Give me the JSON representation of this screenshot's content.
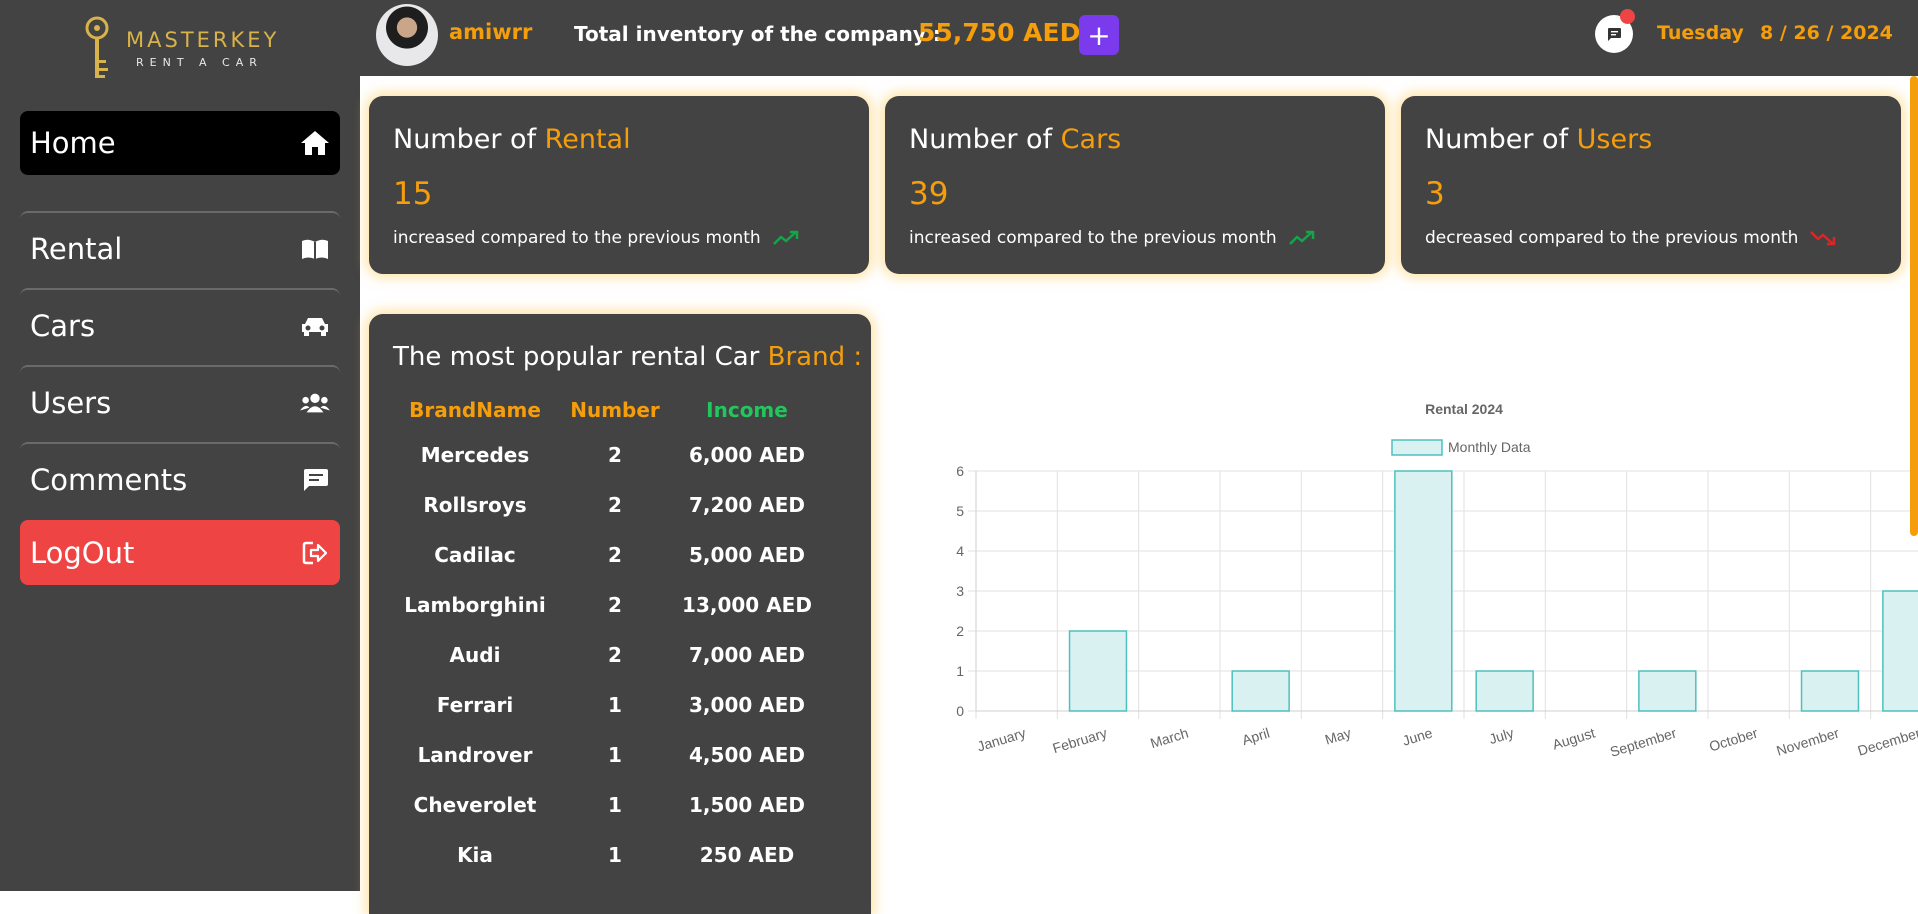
{
  "logo": {
    "brand": "MASTERKEY",
    "sub": "RENT A CAR"
  },
  "sidebar": {
    "items": [
      {
        "label": "Home",
        "icon": "home-icon"
      },
      {
        "label": "Rental",
        "icon": "book-icon"
      },
      {
        "label": "Cars",
        "icon": "car-icon"
      },
      {
        "label": "Users",
        "icon": "users-icon"
      },
      {
        "label": "Comments",
        "icon": "comment-icon"
      },
      {
        "label": "LogOut",
        "icon": "logout-icon"
      }
    ]
  },
  "header": {
    "username": "amiwrr",
    "inventory_label": "Total inventory of the company :",
    "inventory_value": "55,750 AED",
    "add_label": "+",
    "day": "Tuesday",
    "date": "8 / 26 / 2024"
  },
  "stats": [
    {
      "prefix": "Number of",
      "accent": "Rental",
      "value": "15",
      "note": "increased compared to the previous month",
      "trend": "up"
    },
    {
      "prefix": "Number of",
      "accent": "Cars",
      "value": "39",
      "note": "increased compared to the previous month",
      "trend": "up"
    },
    {
      "prefix": "Number of",
      "accent": "Users",
      "value": "3",
      "note": "decreased compared to the previous month",
      "trend": "down"
    }
  ],
  "brands": {
    "title_prefix": "The most popular rental Car",
    "title_accent": "Brand :",
    "headers": [
      "BrandName",
      "Number",
      "Income"
    ],
    "rows": [
      [
        "Mercedes",
        "2",
        "6,000 AED"
      ],
      [
        "Rollsroys",
        "2",
        "7,200 AED"
      ],
      [
        "Cadilac",
        "2",
        "5,000 AED"
      ],
      [
        "Lamborghini",
        "2",
        "13,000 AED"
      ],
      [
        "Audi",
        "2",
        "7,000 AED"
      ],
      [
        "Ferrari",
        "1",
        "3,000 AED"
      ],
      [
        "Landrover",
        "1",
        "4,500 AED"
      ],
      [
        "Cheverolet",
        "1",
        "1,500 AED"
      ],
      [
        "Kia",
        "1",
        "250 AED"
      ]
    ]
  },
  "colors": {
    "accent": "#f59e0b",
    "income": "#22c55e",
    "logout": "#ef4444",
    "add": "#7c3aed",
    "bar_fill": "#daf1f1",
    "bar_stroke": "#4fc0be"
  },
  "chart_data": {
    "type": "bar",
    "title": "Rental 2024",
    "categories": [
      "January",
      "February",
      "March",
      "April",
      "May",
      "June",
      "July",
      "August",
      "September",
      "October",
      "November",
      "December"
    ],
    "series": [
      {
        "name": "Monthly Data",
        "values": [
          0,
          2,
          0,
          1,
          0,
          6,
          1,
          0,
          1,
          0,
          1,
          3
        ]
      }
    ],
    "ylim": [
      0,
      6
    ],
    "yticks": [
      0,
      1,
      2,
      3,
      4,
      5,
      6
    ],
    "grid": true,
    "legend": "top-center"
  }
}
